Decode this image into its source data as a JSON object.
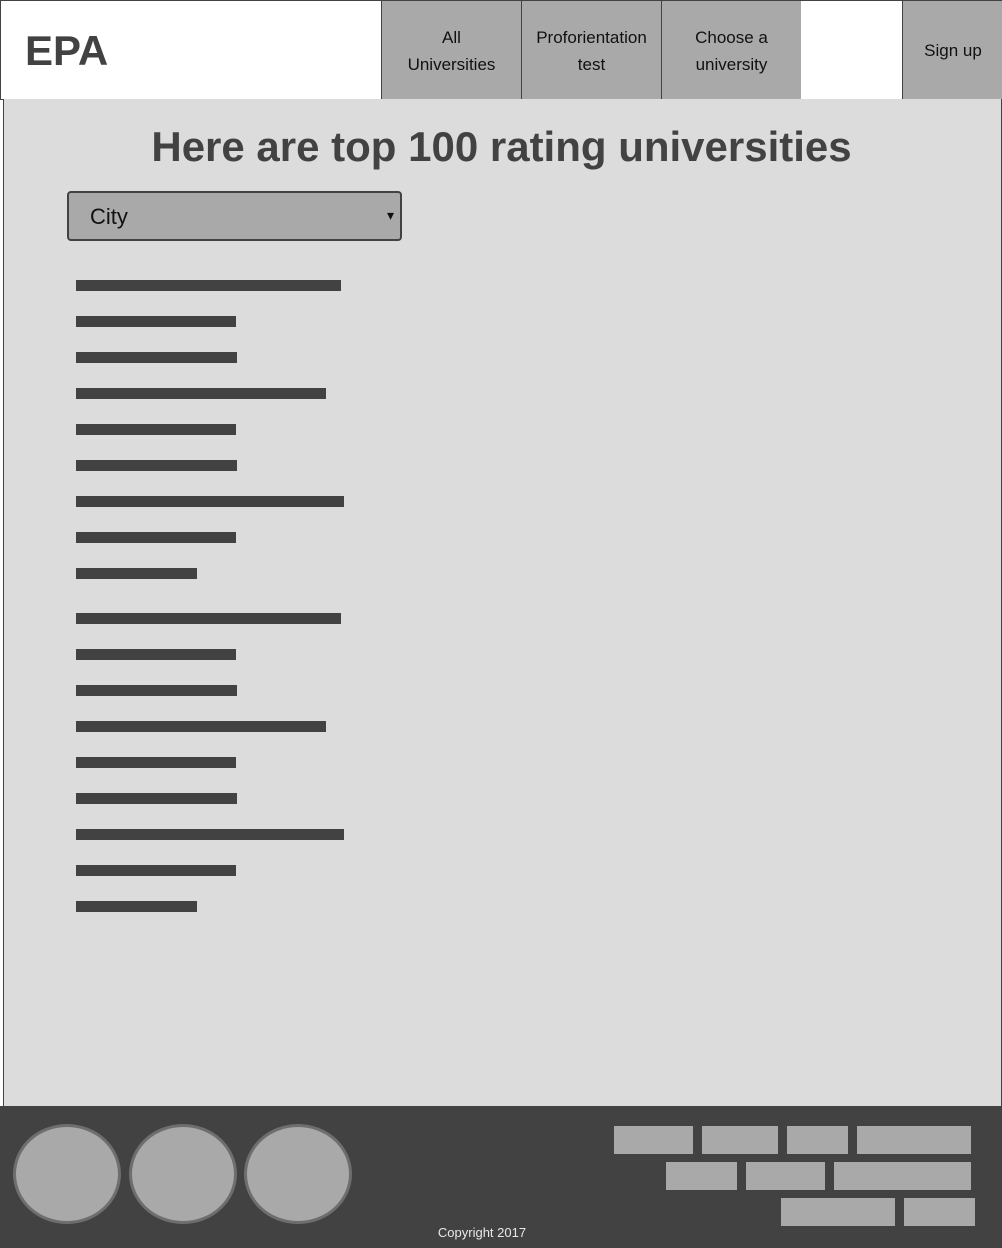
{
  "header": {
    "logo": "EPA",
    "nav": {
      "all_universities": [
        "All",
        "Universities"
      ],
      "proforientation_test": [
        "Proforientation",
        "test"
      ],
      "choose_university": [
        "Choose a",
        "university"
      ],
      "sign_up": "Sign up"
    }
  },
  "main": {
    "title": "Here are top 100 rating universities",
    "city_select": {
      "selected": "City",
      "arrow": "▾"
    }
  },
  "footer": {
    "copyright": "Copyright 2017"
  },
  "colors": {
    "dark": "#424242",
    "mid": "#a9a9a9",
    "panel": "#dcdcdc"
  }
}
